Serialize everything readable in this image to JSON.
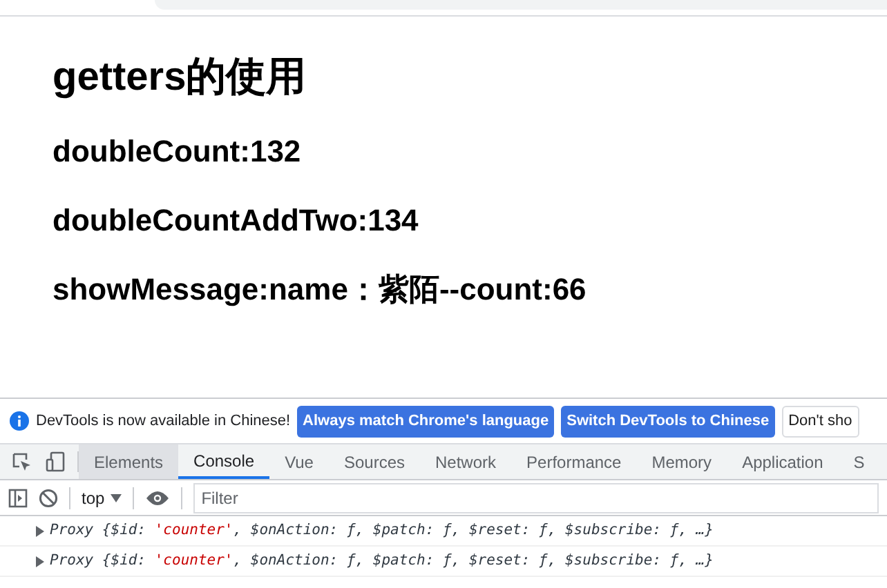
{
  "page": {
    "title": "getters的使用",
    "lines": [
      "doubleCount:132",
      "doubleCountAddTwo:134",
      "showMessage:name：紫陌--count:66"
    ]
  },
  "devtools": {
    "infobar": {
      "message": "DevTools is now available in Chinese!",
      "buttons": [
        {
          "label": "Always match Chrome's language",
          "kind": "primary"
        },
        {
          "label": "Switch DevTools to Chinese",
          "kind": "primary"
        },
        {
          "label": "Don't sho",
          "kind": "secondary"
        }
      ]
    },
    "tabs": [
      {
        "label": "Elements",
        "selected": false,
        "hovered": true
      },
      {
        "label": "Console",
        "selected": true,
        "hovered": false
      },
      {
        "label": "Vue",
        "selected": false,
        "hovered": false
      },
      {
        "label": "Sources",
        "selected": false,
        "hovered": false
      },
      {
        "label": "Network",
        "selected": false,
        "hovered": false
      },
      {
        "label": "Performance",
        "selected": false,
        "hovered": false
      },
      {
        "label": "Memory",
        "selected": false,
        "hovered": false
      },
      {
        "label": "Application",
        "selected": false,
        "hovered": false
      },
      {
        "label": "S",
        "selected": false,
        "hovered": false
      }
    ],
    "context": "top",
    "filter": {
      "placeholder": "Filter"
    },
    "logs": [
      {
        "parts": [
          {
            "text": "Proxy {$id: ",
            "kind": "plain"
          },
          {
            "text": "'counter'",
            "kind": "string"
          },
          {
            "text": ", $onAction: ƒ, $patch: ƒ, $reset: ƒ, $subscribe: ƒ, …}",
            "kind": "plain"
          }
        ]
      },
      {
        "parts": [
          {
            "text": "Proxy {$id: ",
            "kind": "plain"
          },
          {
            "text": "'counter'",
            "kind": "string"
          },
          {
            "text": ", $onAction: ƒ, $patch: ƒ, $reset: ƒ, $subscribe: ƒ, …}",
            "kind": "plain"
          }
        ]
      }
    ]
  }
}
